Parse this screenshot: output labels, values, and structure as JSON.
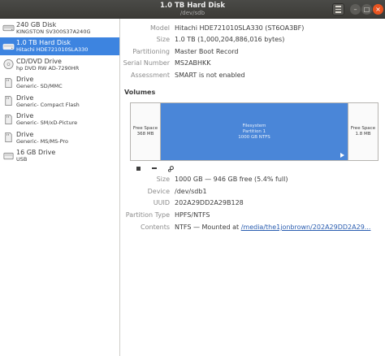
{
  "window": {
    "title": "1.0 TB Hard Disk",
    "subtitle": "/dev/sdb",
    "menu_icon": "hamburger-menu-icon",
    "minimize_glyph": "–",
    "maximize_glyph": "□",
    "close_glyph": "×"
  },
  "sidebar": {
    "drives": [
      {
        "name": "240 GB Disk",
        "desc": "KINGSTON SV300S37A240G",
        "icon": "hard-disk-icon",
        "selected": false
      },
      {
        "name": "1.0 TB Hard Disk",
        "desc": "Hitachi HDE721010SLA330",
        "icon": "hard-disk-icon",
        "selected": true
      },
      {
        "name": "CD/DVD Drive",
        "desc": "hp     DVD RW AD-7290HR",
        "icon": "optical-disc-icon",
        "selected": false
      },
      {
        "name": "Drive",
        "desc": "Generic- SD/MMC",
        "icon": "card-reader-icon",
        "selected": false
      },
      {
        "name": "Drive",
        "desc": "Generic- Compact Flash",
        "icon": "card-reader-icon",
        "selected": false
      },
      {
        "name": "Drive",
        "desc": "Generic- SM/xD-Picture",
        "icon": "card-reader-icon",
        "selected": false
      },
      {
        "name": "Drive",
        "desc": "Generic- MS/MS-Pro",
        "icon": "card-reader-icon",
        "selected": false
      },
      {
        "name": "16 GB Drive",
        "desc": "USB",
        "icon": "usb-drive-icon",
        "selected": false
      }
    ]
  },
  "disk": {
    "model_label": "Model",
    "model": "Hitachi HDE721010SLA330 (ST6OA3BF)",
    "size_label": "Size",
    "size": "1.0 TB (1,000,204,886,016 bytes)",
    "partitioning_label": "Partitioning",
    "partitioning": "Master Boot Record",
    "serial_label": "Serial Number",
    "serial": "MS2ABHKK",
    "assessment_label": "Assessment",
    "assessment": "SMART is not enabled"
  },
  "volumes": {
    "heading": "Volumes",
    "free_left": {
      "line1": "Free Space",
      "line2": "368 MB"
    },
    "filesystem": {
      "line1": "Filesystem",
      "line2": "Partition 1",
      "line3": "1000 GB NTFS"
    },
    "free_right": {
      "line1": "Free Space",
      "line2": "1.8 MB"
    }
  },
  "partition": {
    "size_label": "Size",
    "size": "1000 GB — 946 GB free (5.4% full)",
    "device_label": "Device",
    "device": "/dev/sdb1",
    "uuid_label": "UUID",
    "uuid": "202A29DD2A29B128",
    "type_label": "Partition Type",
    "type": "HPFS/NTFS",
    "contents_label": "Contents",
    "contents_prefix": "NTFS — Mounted at ",
    "mount_link": "/media/the1jonbrown/202A29DD2A29..."
  }
}
